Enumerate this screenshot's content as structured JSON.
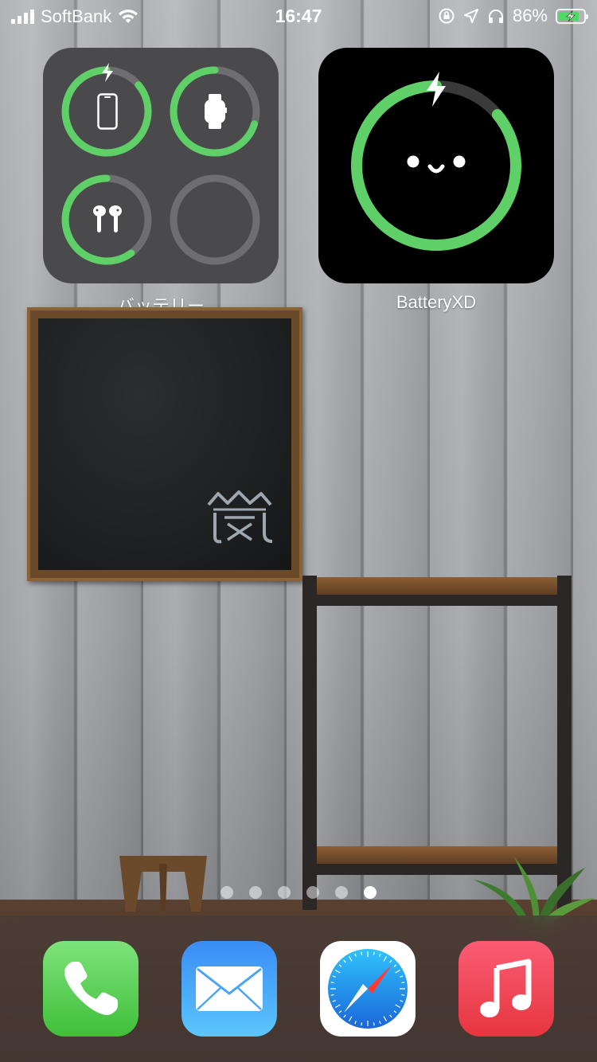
{
  "status_bar": {
    "carrier": "SoftBank",
    "time": "16:47",
    "battery_percent": "86%",
    "battery_level": 0.86,
    "charging": true,
    "icons": [
      "cellular-signal-icon",
      "wifi-icon",
      "orientation-lock-icon",
      "location-arrow-icon",
      "headphones-icon",
      "battery-charging-icon"
    ]
  },
  "widgets": {
    "batteries": {
      "label": "バッテリー",
      "devices": [
        {
          "name": "iphone",
          "icon": "iphone-icon",
          "level": 0.86,
          "charging": true
        },
        {
          "name": "apple-watch",
          "icon": "apple-watch-icon",
          "level": 0.7,
          "charging": false
        },
        {
          "name": "airpods",
          "icon": "airpods-icon",
          "level": 0.6,
          "charging": false
        },
        {
          "name": "empty",
          "icon": "",
          "level": 0,
          "charging": false
        }
      ],
      "colors": {
        "ring": "#5fd068",
        "track": "#6e6e72",
        "background": "#4a4a4c"
      }
    },
    "battery_xd": {
      "label": "BatteryXD",
      "level": 0.86,
      "charging": true,
      "colors": {
        "ring": "#5fd068",
        "track": "#3a3a3a",
        "background": "#000000"
      }
    }
  },
  "wallpaper": {
    "chalkboard_mark": "嵐"
  },
  "page_indicator": {
    "count": 6,
    "active_index": 5
  },
  "dock": {
    "apps": [
      {
        "name": "Phone",
        "icon": "phone-icon"
      },
      {
        "name": "Mail",
        "icon": "mail-icon"
      },
      {
        "name": "Safari",
        "icon": "safari-compass-icon"
      },
      {
        "name": "Music",
        "icon": "music-note-icon"
      }
    ]
  }
}
